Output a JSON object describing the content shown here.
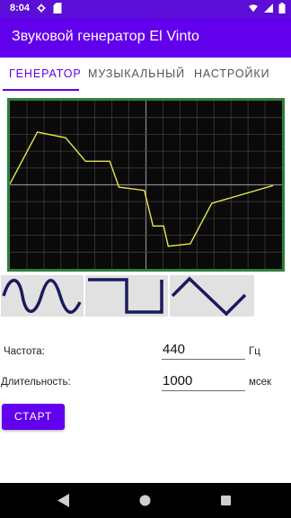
{
  "status_bar": {
    "time": "8:04"
  },
  "app_bar": {
    "title": "Звуковой генератор El Vinto"
  },
  "tabs": [
    {
      "label": "ГЕНЕРАТОР",
      "active": true
    },
    {
      "label": "МУЗЫКАЛЬНЫЙ",
      "active": false
    },
    {
      "label": "НАСТРОЙКИ",
      "active": false
    }
  ],
  "oscilloscope": {
    "trace_color": "#e6e64a",
    "frame_color": "#2f7f3c",
    "trace": [
      [
        0,
        0.0
      ],
      [
        0.101,
        0.64
      ],
      [
        0.205,
        0.57
      ],
      [
        0.278,
        0.28
      ],
      [
        0.367,
        0.28
      ],
      [
        0.401,
        -0.04
      ],
      [
        0.494,
        -0.08
      ],
      [
        0.526,
        -0.52
      ],
      [
        0.565,
        -0.52
      ],
      [
        0.582,
        -0.77
      ],
      [
        0.663,
        -0.74
      ],
      [
        0.742,
        -0.24
      ],
      [
        0.967,
        -0.02
      ]
    ]
  },
  "waveforms": [
    {
      "name": "sine",
      "selected": true
    },
    {
      "name": "square",
      "selected": false
    },
    {
      "name": "triangle",
      "selected": false
    }
  ],
  "form": {
    "frequency_label": "Частота:",
    "frequency_value": "440",
    "frequency_unit": "Гц",
    "duration_label": "Длительность:",
    "duration_value": "1000",
    "duration_unit": "мсек",
    "start_label": "СТАРТ"
  },
  "colors": {
    "accent": "#6200ee",
    "status_bar": "#5b0fd6",
    "wave_icon": "#1a1a5e"
  }
}
